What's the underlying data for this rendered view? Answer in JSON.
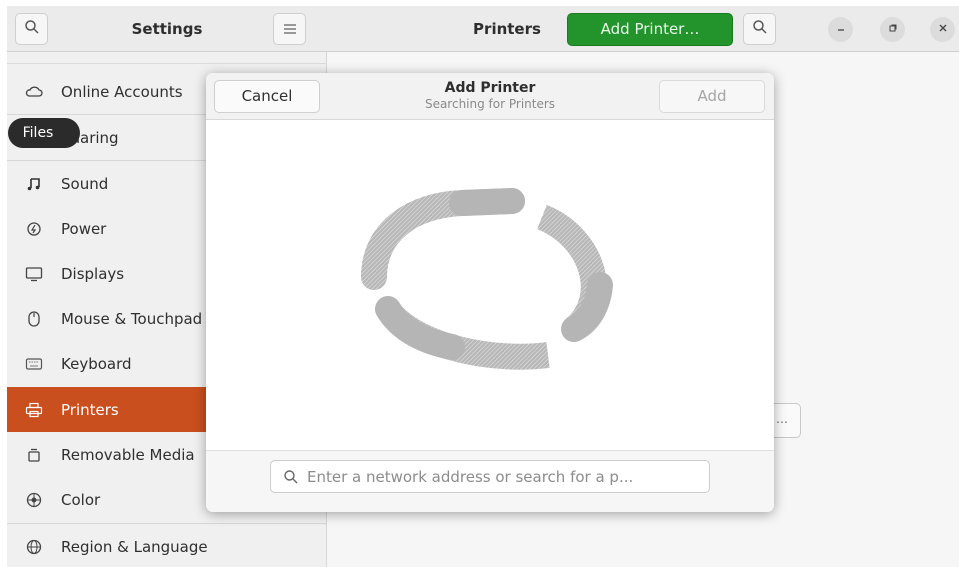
{
  "sidebar": {
    "title": "Settings",
    "search_icon": "search-icon",
    "menu_icon": "hamburger-menu-icon",
    "items": [
      {
        "label": "Online Accounts",
        "icon": "cloud-icon"
      },
      {
        "label": "Sharing",
        "icon": "share-icon"
      },
      {
        "label": "Sound",
        "icon": "music-note-icon"
      },
      {
        "label": "Power",
        "icon": "power-icon"
      },
      {
        "label": "Displays",
        "icon": "display-icon"
      },
      {
        "label": "Mouse & Touchpad",
        "icon": "mouse-icon"
      },
      {
        "label": "Keyboard",
        "icon": "keyboard-icon"
      },
      {
        "label": "Printers",
        "icon": "printer-icon",
        "active": true
      },
      {
        "label": "Removable Media",
        "icon": "removable-media-icon"
      },
      {
        "label": "Color",
        "icon": "color-icon"
      },
      {
        "label": "Region & Language",
        "icon": "globe-icon"
      }
    ]
  },
  "tooltip": {
    "text": "Files"
  },
  "main": {
    "title": "Printers",
    "add_printer_label": "Add Printer…",
    "search_icon": "search-icon",
    "window_controls": [
      "minimize-icon",
      "restore-icon",
      "close-icon"
    ],
    "bg_button_glyph": "…"
  },
  "dialog": {
    "title": "Add Printer",
    "subtitle": "Searching for Printers",
    "cancel_label": "Cancel",
    "add_label": "Add",
    "search": {
      "placeholder": "Enter a network address or search for a p...",
      "value": ""
    }
  },
  "colors": {
    "accent": "#c94f1e",
    "add_printer_button": "#23942b",
    "tooltip_bg": "#2b2b2b"
  }
}
